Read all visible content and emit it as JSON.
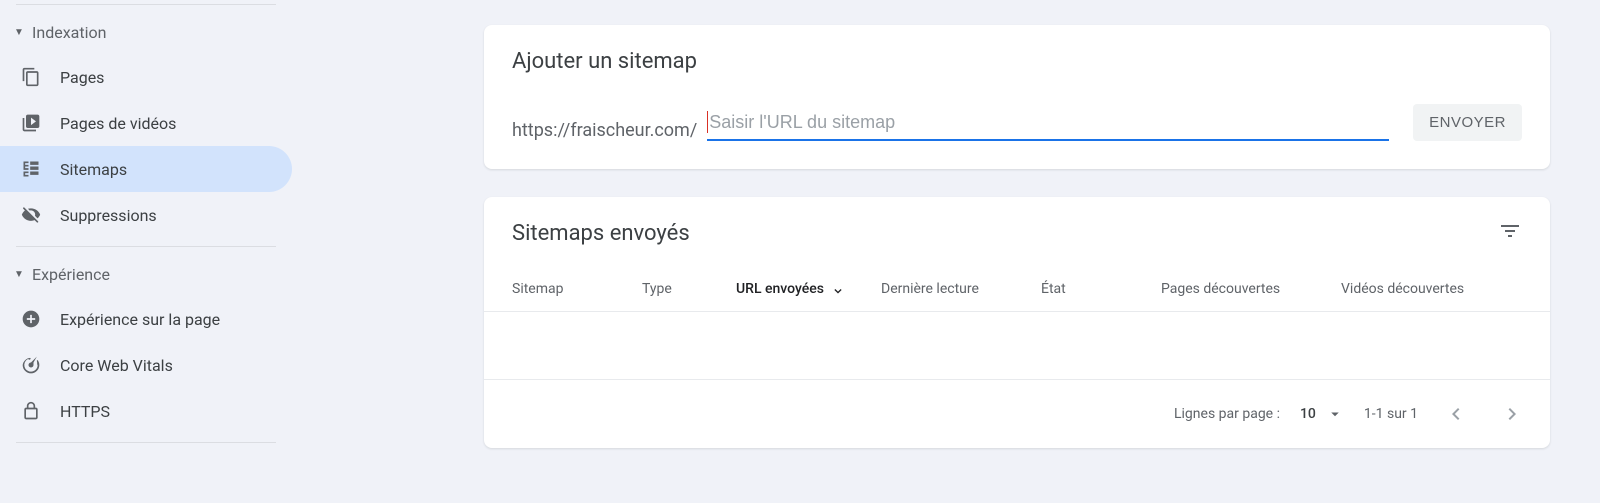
{
  "sidebar": {
    "sections": {
      "indexation": {
        "label": "Indexation"
      },
      "experience": {
        "label": "Expérience"
      }
    },
    "items": {
      "pages": {
        "label": "Pages"
      },
      "video_pages": {
        "label": "Pages de vidéos"
      },
      "sitemaps": {
        "label": "Sitemaps"
      },
      "suppressions": {
        "label": "Suppressions"
      },
      "page_experience": {
        "label": "Expérience sur la page"
      },
      "core_web_vitals": {
        "label": "Core Web Vitals"
      },
      "https": {
        "label": "HTTPS"
      }
    }
  },
  "add_sitemap": {
    "title": "Ajouter un sitemap",
    "url_prefix": "https://fraischeur.com/",
    "input_placeholder": "Saisir l'URL du sitemap",
    "submit_label": "ENVOYER"
  },
  "sitemaps_list": {
    "title": "Sitemaps envoyés",
    "columns": {
      "sitemap": "Sitemap",
      "type": "Type",
      "url_sent": "URL envoyées",
      "last_read": "Dernière lecture",
      "state": "État",
      "pages_discovered": "Pages découvertes",
      "videos_discovered": "Vidéos découvertes"
    },
    "rows": []
  },
  "pagination": {
    "rows_label": "Lignes par page :",
    "rows_value": "10",
    "range": "1-1 sur 1"
  }
}
